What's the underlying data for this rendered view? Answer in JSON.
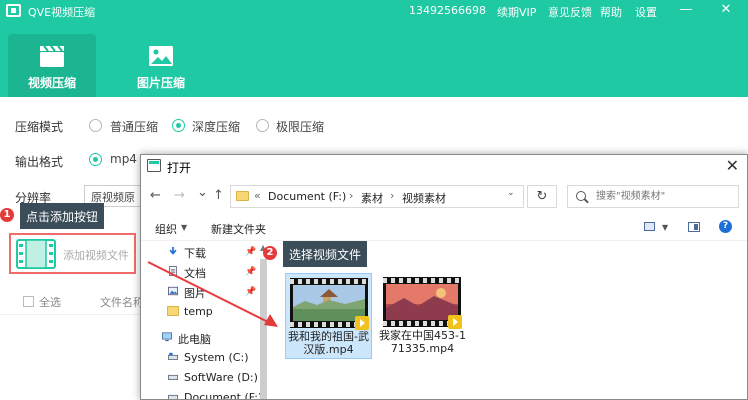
{
  "app": {
    "title": "QVE视频压缩",
    "phone": "13492566698",
    "menu": [
      "续期VIP",
      "意见反馈",
      "帮助",
      "设置"
    ],
    "window_controls": {
      "minimize": "—",
      "close": "✕"
    },
    "tabs": [
      {
        "label": "视频压缩",
        "icon": "clapperboard-icon",
        "active": true
      },
      {
        "label": "图片压缩",
        "icon": "picture-icon",
        "active": false
      }
    ],
    "accent_color": "#1ec9a3"
  },
  "form": {
    "compress_mode_label": "压缩模式",
    "compress_modes": [
      {
        "label": "普通压缩",
        "checked": false
      },
      {
        "label": "深度压缩",
        "checked": true
      },
      {
        "label": "极限压缩",
        "checked": false
      }
    ],
    "output_format_label": "输出格式",
    "output_format_option": "mp4",
    "resolution_label": "分辨率",
    "resolution_value": "原视频原",
    "add_file_button": "添加视频文件",
    "select_all": "全选",
    "column_filename": "文件名称"
  },
  "tips": [
    {
      "number": "1",
      "text": "点击添加按钮"
    },
    {
      "number": "2",
      "text": "选择视频文件"
    }
  ],
  "dialog": {
    "title": "打开",
    "close": "✕",
    "nav": {
      "back": "←",
      "forward": "→",
      "dropdown": "⌄",
      "up": "↑"
    },
    "address": {
      "prefix": "«",
      "segments": [
        "Document (F:)",
        "素材",
        "视频素材"
      ],
      "separator": "›",
      "dropdown": "⌄"
    },
    "refresh": "↻",
    "search_placeholder": "搜索\"视频素材\"",
    "commands": {
      "organize": "组织",
      "new_folder": "新建文件夹",
      "dropdown": "▼",
      "help": "?"
    },
    "sidebar": [
      {
        "label": "下载",
        "icon": "download-icon",
        "pinned": true
      },
      {
        "label": "文档",
        "icon": "document-icon",
        "pinned": true
      },
      {
        "label": "图片",
        "icon": "picture-icon",
        "pinned": true
      },
      {
        "label": "temp",
        "icon": "folder-icon",
        "pinned": false
      },
      {
        "label": "此电脑",
        "icon": "computer-icon",
        "pinned": false
      },
      {
        "label": "System (C:)",
        "icon": "drive-icon",
        "pinned": false
      },
      {
        "label": "SoftWare (D:)",
        "icon": "drive-icon",
        "pinned": false
      },
      {
        "label": "Document (F:)",
        "icon": "drive-icon",
        "pinned": false
      }
    ],
    "pin_glyph": "📌",
    "scroll_up": "▲",
    "files": [
      {
        "name": "我和我的祖国-武汉版.mp4",
        "selected": true
      },
      {
        "name": "我家在中国453-171335.mp4",
        "selected": false
      }
    ]
  }
}
